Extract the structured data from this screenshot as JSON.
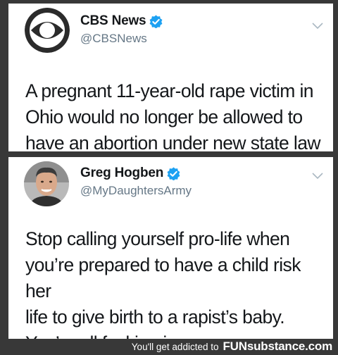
{
  "tweets": [
    {
      "author_name": "CBS News",
      "handle": "@CBSNews",
      "avatar_icon": "cbs-eye-logo-icon",
      "verified_icon": "verified-badge-icon",
      "text": "A pregnant 11-year-old rape victim in\nOhio would no longer be allowed to\nhave an abortion under new state law"
    },
    {
      "author_name": "Greg Hogben",
      "handle": "@MyDaughtersArmy",
      "avatar_icon": "profile-photo-icon",
      "verified_icon": "verified-badge-icon",
      "text": "Stop calling yourself pro-life when\nyou’re prepared to have a child risk her\nlife to give birth to a rapist’s baby.\nYou’re all fucking insane."
    }
  ],
  "footer": {
    "tagline": "You'll get addicted to",
    "brand": "FUNsubstance.com"
  },
  "colors": {
    "verified": "#1da1f2",
    "background": "#383838",
    "text": "#14171a",
    "handle": "#657786"
  }
}
